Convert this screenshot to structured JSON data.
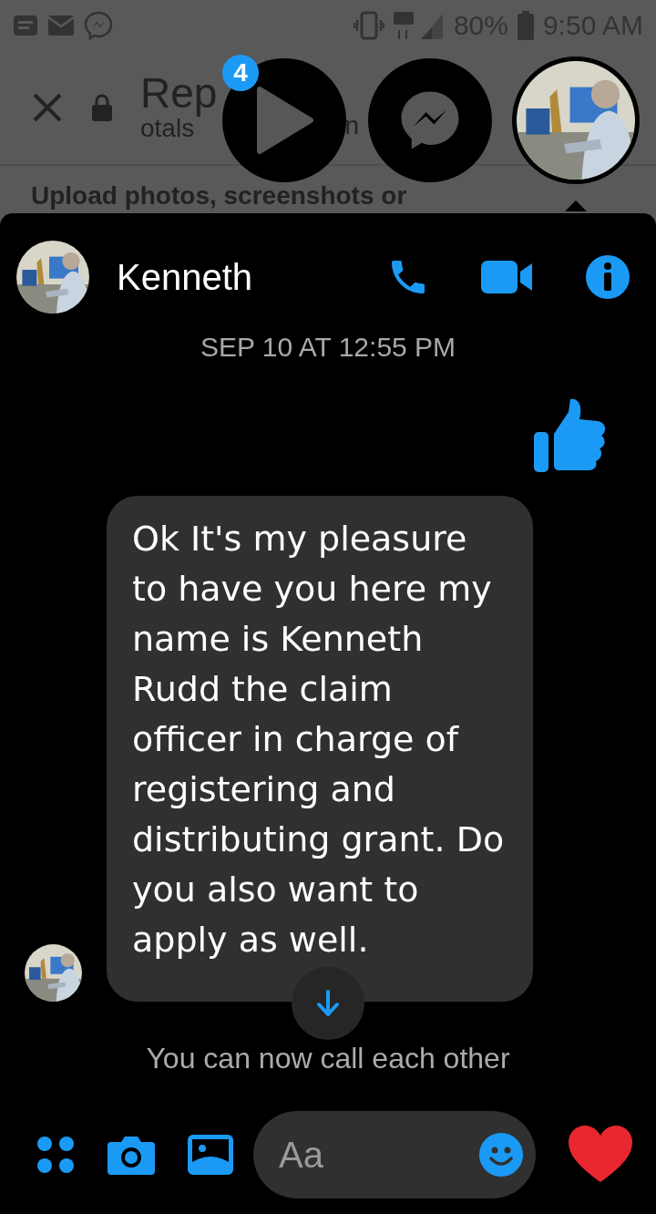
{
  "status_bar": {
    "battery": "80%",
    "time": "9:50 AM"
  },
  "browser": {
    "title": "Rep",
    "subtitle": "otals",
    "subtitle_fragment": "n",
    "heading": "Upload photos, screenshots or"
  },
  "chat_heads": {
    "badge": "4"
  },
  "chat": {
    "contact": "Kenneth",
    "timestamp": "SEP 10 AT 12:55 PM",
    "messages": [
      {
        "kind": "like"
      },
      {
        "kind": "text",
        "text": "Ok It's my pleasure to have you here my name is Kenneth Rudd the claim officer in charge of registering and distributing grant. Do you also want to apply as well."
      }
    ],
    "notice": "You can now call each other"
  },
  "composer": {
    "placeholder": "Aa"
  }
}
